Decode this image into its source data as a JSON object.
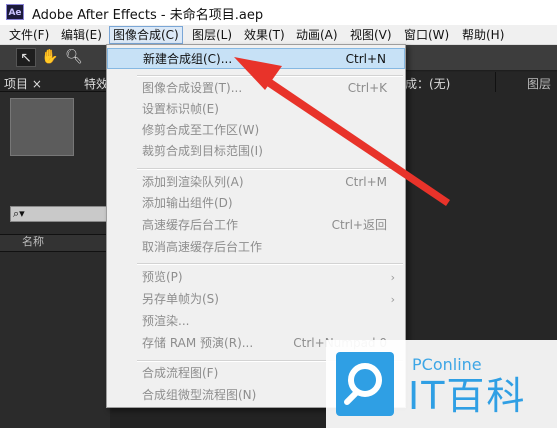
{
  "window": {
    "title": "Adobe After Effects - 未命名项目.aep",
    "app_icon": "Ae"
  },
  "menubar": {
    "items": [
      {
        "label": "文件(F)"
      },
      {
        "label": "编辑(E)"
      },
      {
        "label": "图像合成(C)",
        "active": true
      },
      {
        "label": "图层(L)"
      },
      {
        "label": "效果(T)"
      },
      {
        "label": "动画(A)"
      },
      {
        "label": "视图(V)"
      },
      {
        "label": "窗口(W)"
      },
      {
        "label": "帮助(H)"
      }
    ]
  },
  "toolbar": {
    "tools": [
      "selection-tool-icon",
      "hand-tool-icon",
      "zoom-tool-icon"
    ]
  },
  "project_panel": {
    "tabs": [
      "项目",
      "特效"
    ],
    "close_glyph": "×",
    "search_icon": "search-icon",
    "name_column": "名称"
  },
  "right_panel": {
    "composition_tab": "成：(无)",
    "layer_tab": "图层"
  },
  "composition_menu": {
    "items": [
      {
        "label": "新建合成组(C)...",
        "shortcut": "Ctrl+N",
        "enabled": true,
        "highlighted": true
      },
      {
        "separator": true
      },
      {
        "label": "图像合成设置(T)...",
        "shortcut": "Ctrl+K",
        "enabled": false
      },
      {
        "label": "设置标识帧(E)",
        "shortcut": "",
        "enabled": false
      },
      {
        "label": "修剪合成至工作区(W)",
        "shortcut": "",
        "enabled": false
      },
      {
        "label": "裁剪合成到目标范围(I)",
        "shortcut": "",
        "enabled": false
      },
      {
        "separator": true
      },
      {
        "label": "添加到渲染队列(A)",
        "shortcut": "Ctrl+M",
        "enabled": false
      },
      {
        "label": "添加输出组件(D)",
        "shortcut": "",
        "enabled": false
      },
      {
        "label": "高速缓存后台工作",
        "shortcut": "Ctrl+返回",
        "enabled": false
      },
      {
        "label": "取消高速缓存后台工作",
        "shortcut": "",
        "enabled": false
      },
      {
        "separator": true
      },
      {
        "label": "预览(P)",
        "shortcut": "",
        "enabled": false,
        "submenu": true
      },
      {
        "label": "另存单帧为(S)",
        "shortcut": "",
        "enabled": false,
        "submenu": true
      },
      {
        "label": "预渲染...",
        "shortcut": "",
        "enabled": false
      },
      {
        "label": "存储 RAM 预演(R)...",
        "shortcut": "Ctrl+Numpad 0",
        "enabled": false
      },
      {
        "separator": true
      },
      {
        "label": "合成流程图(F)",
        "shortcut": "",
        "enabled": false
      },
      {
        "label": "合成组微型流程图(N)",
        "shortcut": "",
        "enabled": false
      }
    ]
  },
  "watermark": {
    "name": "PConline",
    "big_text": "IT百科"
  },
  "colors": {
    "annotation_arrow": "#e8332a",
    "highlight": "#c7e1f6",
    "watermark_blue": "#2f9fe4"
  }
}
